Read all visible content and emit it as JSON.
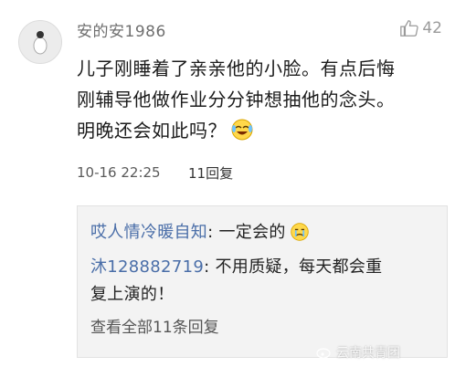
{
  "comment": {
    "username": "安的安1986",
    "like_count": "42",
    "text_line1": "儿子刚睡着了亲亲他的小脸。有点后悔",
    "text_line2": "刚辅导他做作业分分钟想抽他的念头。",
    "text_line3": "明晚还会如此吗？",
    "timestamp": "10-16 22:25",
    "reply_count_label": "11回复"
  },
  "replies": {
    "items": [
      {
        "name": "哎人情冷暖自知",
        "text": ": 一定会的"
      },
      {
        "name": "沐128882719",
        "text": ": 不用质疑，每天都会重",
        "text2": "复上演的！"
      }
    ],
    "view_all_label": "查看全部11条回复"
  },
  "watermark": "云南共青团",
  "colors": {
    "name_link": "#4a6ea8",
    "reply_bg": "#f3f3f3"
  }
}
